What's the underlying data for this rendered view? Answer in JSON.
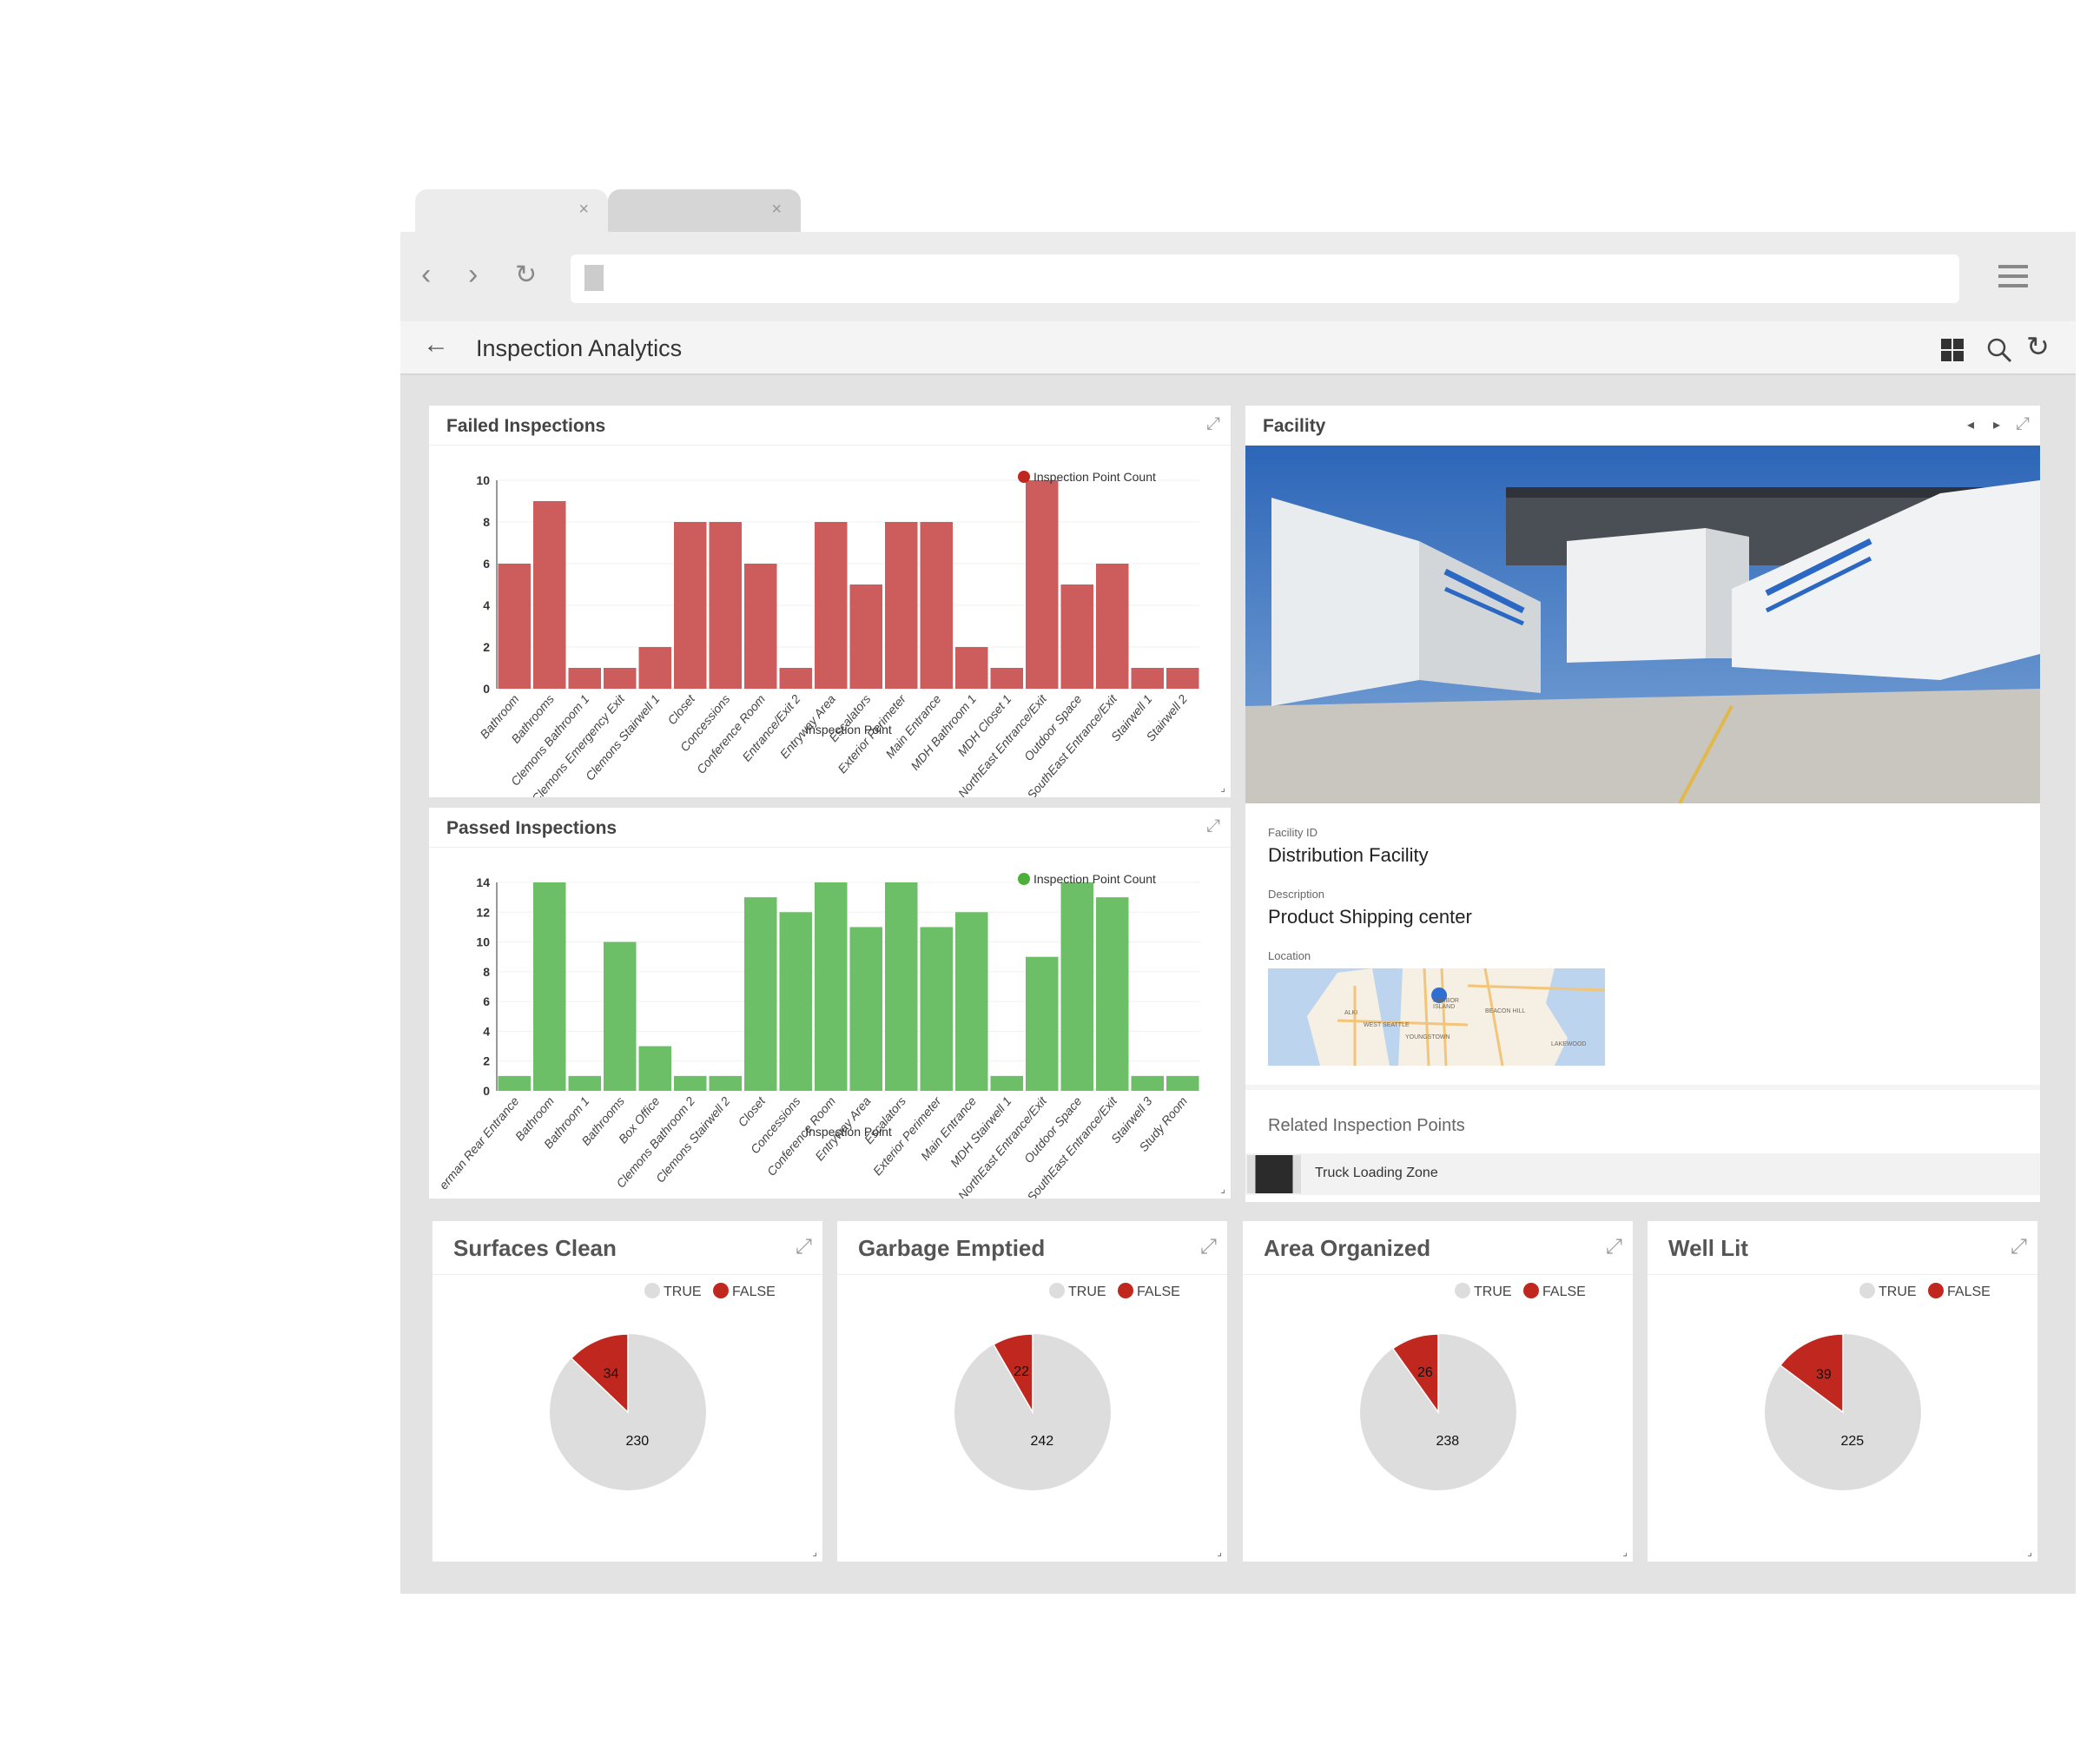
{
  "browser": {
    "tabs": [
      {
        "close": "×"
      },
      {
        "close": "×"
      }
    ],
    "menu_icon": "hamburger-icon"
  },
  "app": {
    "title": "Inspection Analytics",
    "icons": [
      "back-arrow-icon",
      "grid-icon",
      "search-icon",
      "refresh-icon"
    ]
  },
  "colors": {
    "failed": "#cd5c5c",
    "passed": "#6dbf67",
    "true": "#dddddd",
    "false": "#c0281f",
    "legend_red": "#c0281f",
    "legend_green": "#4caf3a"
  },
  "failed_panel": {
    "title": "Failed Inspections"
  },
  "passed_panel": {
    "title": "Passed Inspections"
  },
  "chart_data": [
    {
      "type": "bar",
      "title": "Failed Inspections",
      "legend": "Inspection Point Count",
      "legend_position": "top-right",
      "xlabel": "Inspection Point",
      "ylabel": "",
      "ylim": [
        0,
        10
      ],
      "yticks": [
        0,
        2,
        4,
        6,
        8,
        10
      ],
      "grid": true,
      "categories": [
        "Bathroom",
        "Bathrooms",
        "Clemons Bathroom 1",
        "Clemons Emergency Exit",
        "Clemons Stairwell 1",
        "Closet",
        "Concessions",
        "Conference Room",
        "Entrance/Exit 2",
        "Entryway Area",
        "Escalators",
        "Exterior Perimeter",
        "Main Entrance",
        "MDH Bathroom 1",
        "MDH Closet 1",
        "NorthEast Entrance/Exit",
        "Outdoor Space",
        "SouthEast Entrance/Exit",
        "Stairwell 1",
        "Stairwell 2"
      ],
      "values": [
        6,
        9,
        1,
        1,
        2,
        8,
        8,
        6,
        1,
        8,
        5,
        8,
        8,
        2,
        1,
        10,
        5,
        6,
        1,
        1
      ]
    },
    {
      "type": "bar",
      "title": "Passed Inspections",
      "legend": "Inspection Point Count",
      "legend_position": "top-right",
      "xlabel": "Inspection Point",
      "ylabel": "",
      "ylim": [
        0,
        14
      ],
      "yticks": [
        0,
        2,
        4,
        6,
        8,
        10,
        12,
        14
      ],
      "grid": true,
      "categories": [
        "erman Rear Entrance",
        "Bathroom",
        "Bathroom 1",
        "Bathrooms",
        "Box Office",
        "Clemons Bathroom 2",
        "Clemons Stairwell 2",
        "Closet",
        "Concessions",
        "Conference Room",
        "Entryway Area",
        "Escalators",
        "Exterior Perimeter",
        "Main Entrance",
        "MDH Stairwell 1",
        "NorthEast Entrance/Exit",
        "Outdoor Space",
        "SouthEast Entrance/Exit",
        "Stairwell 3",
        "Study Room"
      ],
      "values": [
        1,
        14,
        1,
        10,
        3,
        1,
        1,
        13,
        12,
        14,
        11,
        14,
        11,
        12,
        1,
        9,
        14,
        13,
        1,
        1
      ]
    },
    {
      "type": "pie",
      "title": "Surfaces Clean",
      "legend": [
        "TRUE",
        "FALSE"
      ],
      "values": {
        "TRUE": 230,
        "FALSE": 34
      }
    },
    {
      "type": "pie",
      "title": "Garbage Emptied",
      "legend": [
        "TRUE",
        "FALSE"
      ],
      "values": {
        "TRUE": 242,
        "FALSE": 22
      }
    },
    {
      "type": "pie",
      "title": "Area Organized",
      "legend": [
        "TRUE",
        "FALSE"
      ],
      "values": {
        "TRUE": 238,
        "FALSE": 26
      }
    },
    {
      "type": "pie",
      "title": "Well Lit",
      "legend": [
        "TRUE",
        "FALSE"
      ],
      "values": {
        "TRUE": 225,
        "FALSE": 39
      }
    }
  ],
  "facility": {
    "title": "Facility",
    "id_label": "Facility ID",
    "id_value": "Distribution Facility",
    "desc_label": "Description",
    "desc_value": "Product Shipping center",
    "loc_label": "Location",
    "map_labels": [
      "ALKI",
      "WEST SEATTLE",
      "HARBOR ISLAND",
      "YOUNGSTOWN",
      "BEACON HILL",
      "LAKEWOOD"
    ],
    "related_title": "Related Inspection Points",
    "related": [
      {
        "label": "Truck Loading Zone"
      }
    ]
  }
}
